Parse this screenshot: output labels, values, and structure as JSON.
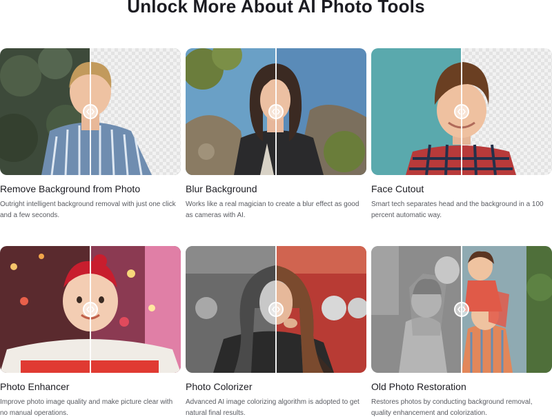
{
  "page": {
    "title": "Unlock More About AI Photo Tools"
  },
  "tools": [
    {
      "label": "Remove Background from Photo",
      "description": "Outright intelligent background removal with just one click and a few seconds."
    },
    {
      "label": "Blur Background",
      "description": "Works like a real magician to create a blur effect as good as cameras with AI."
    },
    {
      "label": "Face Cutout",
      "description": "Smart tech separates head and the background in a 100 percent automatic way."
    },
    {
      "label": "Photo Enhancer",
      "description": "Improve photo image quality and make picture clear with no manual operations."
    },
    {
      "label": "Photo Colorizer",
      "description": "Advanced AI image colorizing algorithm is adopted to get natural final results."
    },
    {
      "label": "Old Photo Restoration",
      "description": "Restores photos by conducting background removal, quality enhancement and colorization."
    }
  ],
  "icons": {
    "compare_handle": "left-right-arrows-icon"
  },
  "colors": {
    "heading": "#1c1c22",
    "body_text": "#585a60",
    "checker": "#e3e3e3"
  }
}
